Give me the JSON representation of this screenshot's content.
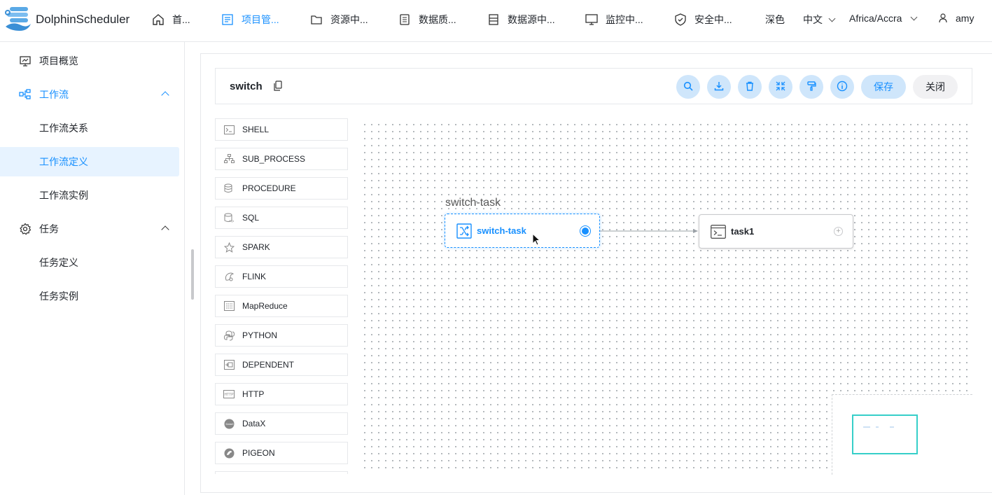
{
  "app": {
    "name": "DolphinScheduler",
    "accent": "#1890ff"
  },
  "header": {
    "nav": [
      {
        "label": "首...",
        "icon": "home-icon"
      },
      {
        "label": "项目管...",
        "icon": "project-icon",
        "active": true
      },
      {
        "label": "资源中...",
        "icon": "folder-icon"
      },
      {
        "label": "数据质...",
        "icon": "data-quality-icon"
      },
      {
        "label": "数据源中...",
        "icon": "datasource-icon"
      },
      {
        "label": "监控中...",
        "icon": "monitor-icon"
      },
      {
        "label": "安全中...",
        "icon": "shield-icon"
      }
    ],
    "theme_label": "深色",
    "language_label": "中文",
    "timezone_label": "Africa/Accra",
    "user_label": "amy"
  },
  "sidebar": {
    "items": [
      {
        "label": "项目概览",
        "icon": "presentation-icon"
      },
      {
        "label": "工作流",
        "icon": "workflow-icon"
      },
      {
        "label": "工作流关系"
      },
      {
        "label": "工作流定义"
      },
      {
        "label": "工作流实例"
      },
      {
        "label": "任务",
        "icon": "gear-icon"
      },
      {
        "label": "任务定义"
      },
      {
        "label": "任务实例"
      }
    ]
  },
  "toolbar": {
    "workflow_name": "switch",
    "save_label": "保存",
    "close_label": "关闭",
    "tools": [
      "search-icon",
      "download-icon",
      "trash-icon",
      "fullscreen-icon",
      "format-brush-icon",
      "info-icon"
    ]
  },
  "palette": {
    "items": [
      {
        "label": "SHELL",
        "icon": "shell-icon"
      },
      {
        "label": "SUB_PROCESS",
        "icon": "sub-process-icon"
      },
      {
        "label": "PROCEDURE",
        "icon": "procedure-icon"
      },
      {
        "label": "SQL",
        "icon": "sql-icon"
      },
      {
        "label": "SPARK",
        "icon": "spark-icon"
      },
      {
        "label": "FLINK",
        "icon": "flink-icon"
      },
      {
        "label": "MapReduce",
        "icon": "mapreduce-icon"
      },
      {
        "label": "PYTHON",
        "icon": "python-icon"
      },
      {
        "label": "DEPENDENT",
        "icon": "dependent-icon"
      },
      {
        "label": "HTTP",
        "icon": "http-icon"
      },
      {
        "label": "DataX",
        "icon": "datax-icon"
      },
      {
        "label": "PIGEON",
        "icon": "pigeon-icon"
      }
    ]
  },
  "canvas": {
    "hover_title": "switch-task",
    "nodes": [
      {
        "label": "switch-task",
        "icon": "switch-icon",
        "selected": true
      },
      {
        "label": "task1",
        "icon": "shell-icon",
        "selected": false
      }
    ]
  }
}
